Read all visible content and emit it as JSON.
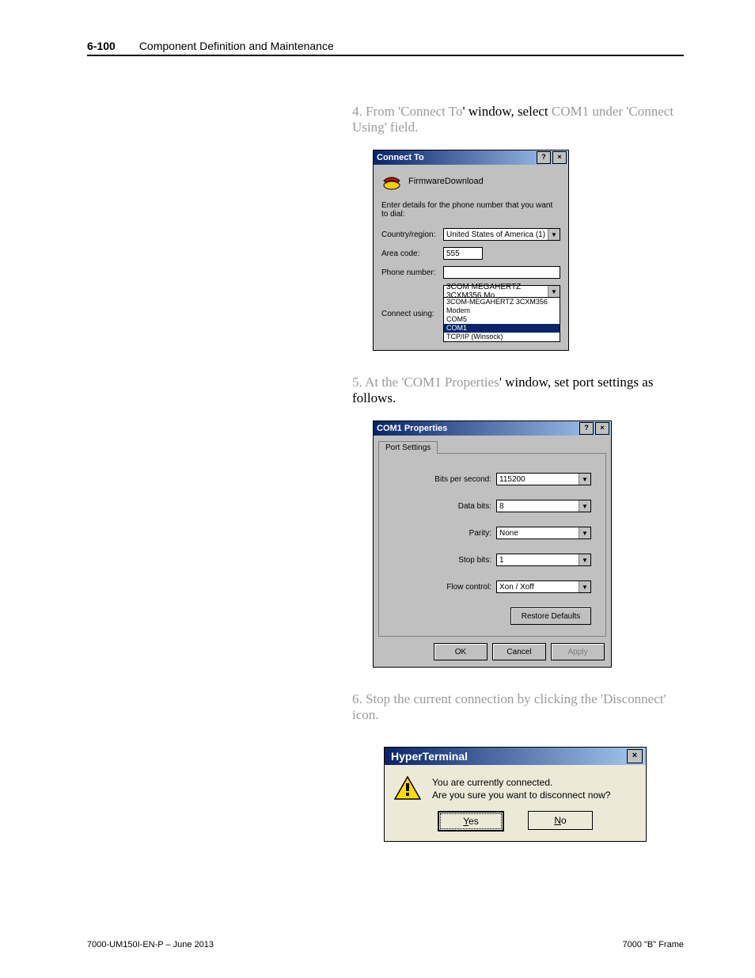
{
  "header": {
    "page_num": "6-100",
    "section": "Component Definition and Maintenance"
  },
  "step4": {
    "prefix": "4.  From  '",
    "win_name": "Connect To",
    "mid": "'  window,  select  ",
    "com_hint": "COM1",
    "suffix": "  under  'Connect Using' field."
  },
  "connect_to": {
    "title": "Connect To",
    "app_name": "FirmwareDownload",
    "instruction": "Enter details for the phone number that you want to dial:",
    "country_label": "Country/region:",
    "country_value": "United States of America (1)",
    "area_label": "Area code:",
    "area_value": "555",
    "phone_label": "Phone number:",
    "connect_label": "Connect using:",
    "connect_value": "3COM MEGAHERTZ 3CXM356 Mo",
    "options": [
      "3COM-MEGAHERTZ 3CXM356 Modem",
      "COM5",
      "COM1",
      "TCP/IP (Winsock)"
    ],
    "selected_index": 2
  },
  "step5": {
    "prefix": "5.  At the '",
    "win_name": "COM1 Properties",
    "mid": "' window, set port settings as follows."
  },
  "com1": {
    "title": "COM1 Properties",
    "tab": "Port Settings",
    "rows": {
      "bps_label": "Bits per second:",
      "bps_value": "115200",
      "databits_label": "Data bits:",
      "databits_value": "8",
      "parity_label": "Parity:",
      "parity_value": "None",
      "stopbits_label": "Stop bits:",
      "stopbits_value": "1",
      "flow_label": "Flow control:",
      "flow_value": "Xon / Xoff"
    },
    "restore": "Restore Defaults",
    "ok": "OK",
    "cancel": "Cancel",
    "apply": "Apply"
  },
  "step6": {
    "text": "6.  Stop the current connection by clicking the 'Disconnect' icon."
  },
  "msgbox": {
    "title": "HyperTerminal",
    "line1": "You are currently connected.",
    "line2": "Are you sure you want to disconnect now?",
    "yes_u": "Y",
    "yes_rest": "es",
    "no_u": "N",
    "no_rest": "o"
  },
  "footer": {
    "left": "7000-UM150I-EN-P – June 2013",
    "right": "7000 \"B\" Frame"
  }
}
